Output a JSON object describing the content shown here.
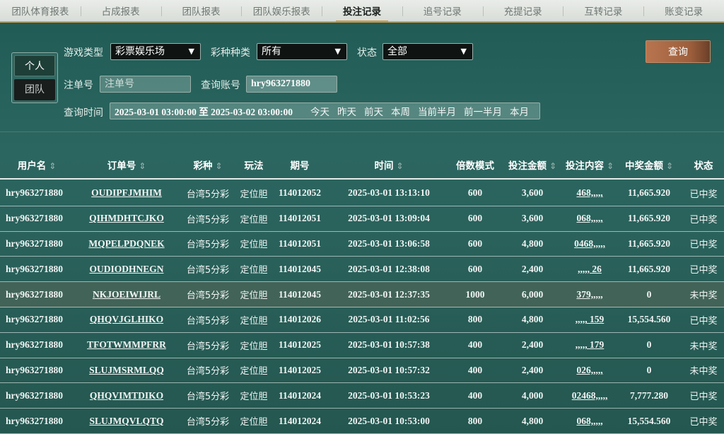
{
  "tabs": [
    {
      "label": "团队体育报表",
      "active": false
    },
    {
      "label": "占成报表",
      "active": false
    },
    {
      "label": "团队报表",
      "active": false
    },
    {
      "label": "团队娱乐报表",
      "active": false
    },
    {
      "label": "投注记录",
      "active": true
    },
    {
      "label": "追号记录",
      "active": false
    },
    {
      "label": "充提记录",
      "active": false
    },
    {
      "label": "互转记录",
      "active": false
    },
    {
      "label": "账变记录",
      "active": false
    }
  ],
  "filters": {
    "scope_personal": "个人",
    "scope_team": "团队",
    "game_type_label": "游戏类型",
    "game_type_value": "彩票娱乐场",
    "lottery_type_label": "彩种种类",
    "lottery_type_value": "所有",
    "status_label": "状态",
    "status_value": "全部",
    "order_no_label": "注单号",
    "order_no_placeholder": "注单号",
    "account_label": "查询账号",
    "account_value": "hry963271880",
    "time_label": "查询时间",
    "time_range": "2025-03-01 03:00:00 至 2025-03-02 03:00:00",
    "quick": [
      "今天",
      "昨天",
      "前天",
      "本周",
      "当前半月",
      "前一半月",
      "本月"
    ],
    "query_button": "查询"
  },
  "table": {
    "headers": [
      "用户名",
      "订单号",
      "彩种",
      "玩法",
      "期号",
      "时间",
      "倍数模式",
      "投注金额",
      "投注内容",
      "中奖金额",
      "状态"
    ],
    "rows": [
      {
        "user": "hry963271880",
        "order": "OUDIPFJMHIM",
        "lottery": "台湾5分彩",
        "play": "定位胆",
        "issue": "114012052",
        "time": "2025-03-01 13:13:10",
        "multiple": "600",
        "amount": "3,600",
        "content": "468,,,,,",
        "win": "11,665.920",
        "status": "已中奖"
      },
      {
        "user": "hry963271880",
        "order": "QIHMDHTCJKO",
        "lottery": "台湾5分彩",
        "play": "定位胆",
        "issue": "114012051",
        "time": "2025-03-01 13:09:04",
        "multiple": "600",
        "amount": "3,600",
        "content": "068,,,,,",
        "win": "11,665.920",
        "status": "已中奖"
      },
      {
        "user": "hry963271880",
        "order": "MQPELPDQNEK",
        "lottery": "台湾5分彩",
        "play": "定位胆",
        "issue": "114012051",
        "time": "2025-03-01 13:06:58",
        "multiple": "600",
        "amount": "4,800",
        "content": "0468,,,,,",
        "win": "11,665.920",
        "status": "已中奖"
      },
      {
        "user": "hry963271880",
        "order": "OUDIODHNEGN",
        "lottery": "台湾5分彩",
        "play": "定位胆",
        "issue": "114012045",
        "time": "2025-03-01 12:38:08",
        "multiple": "600",
        "amount": "2,400",
        "content": ",,,,, 26",
        "win": "11,665.920",
        "status": "已中奖"
      },
      {
        "user": "hry963271880",
        "order": "NKJOEIWIJRL",
        "lottery": "台湾5分彩",
        "play": "定位胆",
        "issue": "114012045",
        "time": "2025-03-01 12:37:35",
        "multiple": "1000",
        "amount": "6,000",
        "content": "379,,,,,",
        "win": "0",
        "status": "未中奖"
      },
      {
        "user": "hry963271880",
        "order": "QHQVJGLHIKO",
        "lottery": "台湾5分彩",
        "play": "定位胆",
        "issue": "114012026",
        "time": "2025-03-01 11:02:56",
        "multiple": "800",
        "amount": "4,800",
        "content": ",,,,, 159",
        "win": "15,554.560",
        "status": "已中奖"
      },
      {
        "user": "hry963271880",
        "order": "TFOTWMMPFRR",
        "lottery": "台湾5分彩",
        "play": "定位胆",
        "issue": "114012025",
        "time": "2025-03-01 10:57:38",
        "multiple": "400",
        "amount": "2,400",
        "content": ",,,,, 179",
        "win": "0",
        "status": "未中奖"
      },
      {
        "user": "hry963271880",
        "order": "SLUJMSRMLQQ",
        "lottery": "台湾5分彩",
        "play": "定位胆",
        "issue": "114012025",
        "time": "2025-03-01 10:57:32",
        "multiple": "400",
        "amount": "2,400",
        "content": "026,,,,,",
        "win": "0",
        "status": "未中奖"
      },
      {
        "user": "hry963271880",
        "order": "QHQVIMTDIKO",
        "lottery": "台湾5分彩",
        "play": "定位胆",
        "issue": "114012024",
        "time": "2025-03-01 10:53:23",
        "multiple": "400",
        "amount": "4,000",
        "content": "02468,,,,,",
        "win": "7,777.280",
        "status": "已中奖"
      },
      {
        "user": "hry963271880",
        "order": "SLUJMQVLQTQ",
        "lottery": "台湾5分彩",
        "play": "定位胆",
        "issue": "114012024",
        "time": "2025-03-01 10:53:00",
        "multiple": "800",
        "amount": "4,800",
        "content": "068,,,,,",
        "win": "15,554.560",
        "status": "已中奖"
      }
    ]
  },
  "colors": {
    "accent_gold": "#c49a4c",
    "query_button": "#a8663f",
    "background": "#2c6660"
  }
}
